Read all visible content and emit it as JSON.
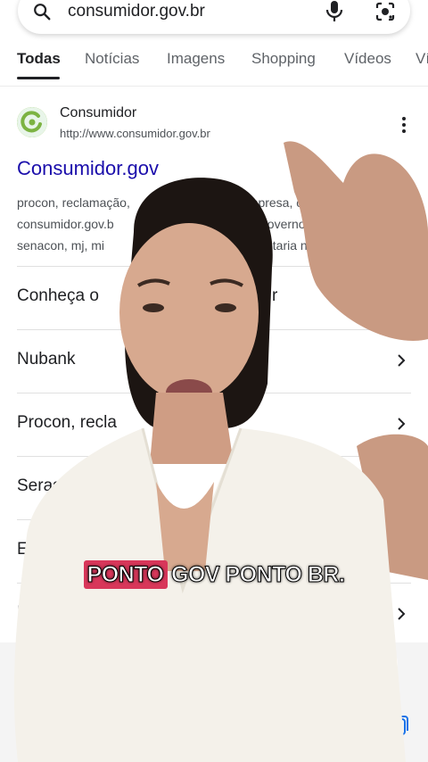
{
  "search": {
    "query": "consumidor.gov.br"
  },
  "tabs": [
    {
      "label": "Todas"
    },
    {
      "label": "Notícias"
    },
    {
      "label": "Imagens"
    },
    {
      "label": "Shopping"
    },
    {
      "label": "Vídeos"
    },
    {
      "label": "Ví"
    }
  ],
  "result": {
    "site_name": "Consumidor",
    "url": "http://www.consumidor.gov.br",
    "title": "Consumidor.gov",
    "snippet_lines": [
      "procon, reclamação,",
      "consumidor.gov.b",
      "senacon, mj, mi"
    ],
    "snippet_right": [
      "empresa, c",
      "governo,",
      "etaria na"
    ]
  },
  "sitelinks": [
    {
      "label": "Conheça o"
    },
    {
      "label": "Nubank"
    },
    {
      "label": "Procon, recla"
    },
    {
      "label": "Seras"
    },
    {
      "label": "E"
    },
    {
      "label": "I"
    }
  ],
  "sitelink_tail": "r",
  "caption": {
    "highlight": "PONTO",
    "rest": "GOV PONTO BR."
  },
  "colors": {
    "link": "#1a0dab",
    "caption_highlight": "#d8375a",
    "favicon": "#8bc34a"
  }
}
